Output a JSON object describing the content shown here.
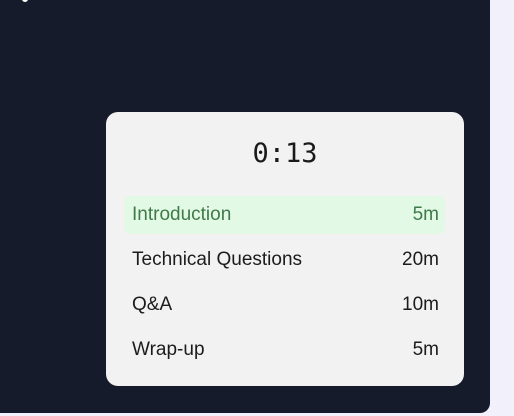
{
  "timer": {
    "elapsed": "0:13"
  },
  "agenda": [
    {
      "label": "Introduction",
      "duration": "5m",
      "active": true
    },
    {
      "label": "Technical Questions",
      "duration": "20m",
      "active": false
    },
    {
      "label": "Q&A",
      "duration": "10m",
      "active": false
    },
    {
      "label": "Wrap-up",
      "duration": "5m",
      "active": false
    }
  ],
  "colors": {
    "app_background": "#151b2b",
    "card_background": "#f2f2f2",
    "active_item_background": "#e2f9e5",
    "active_item_text": "#3f7a48"
  }
}
